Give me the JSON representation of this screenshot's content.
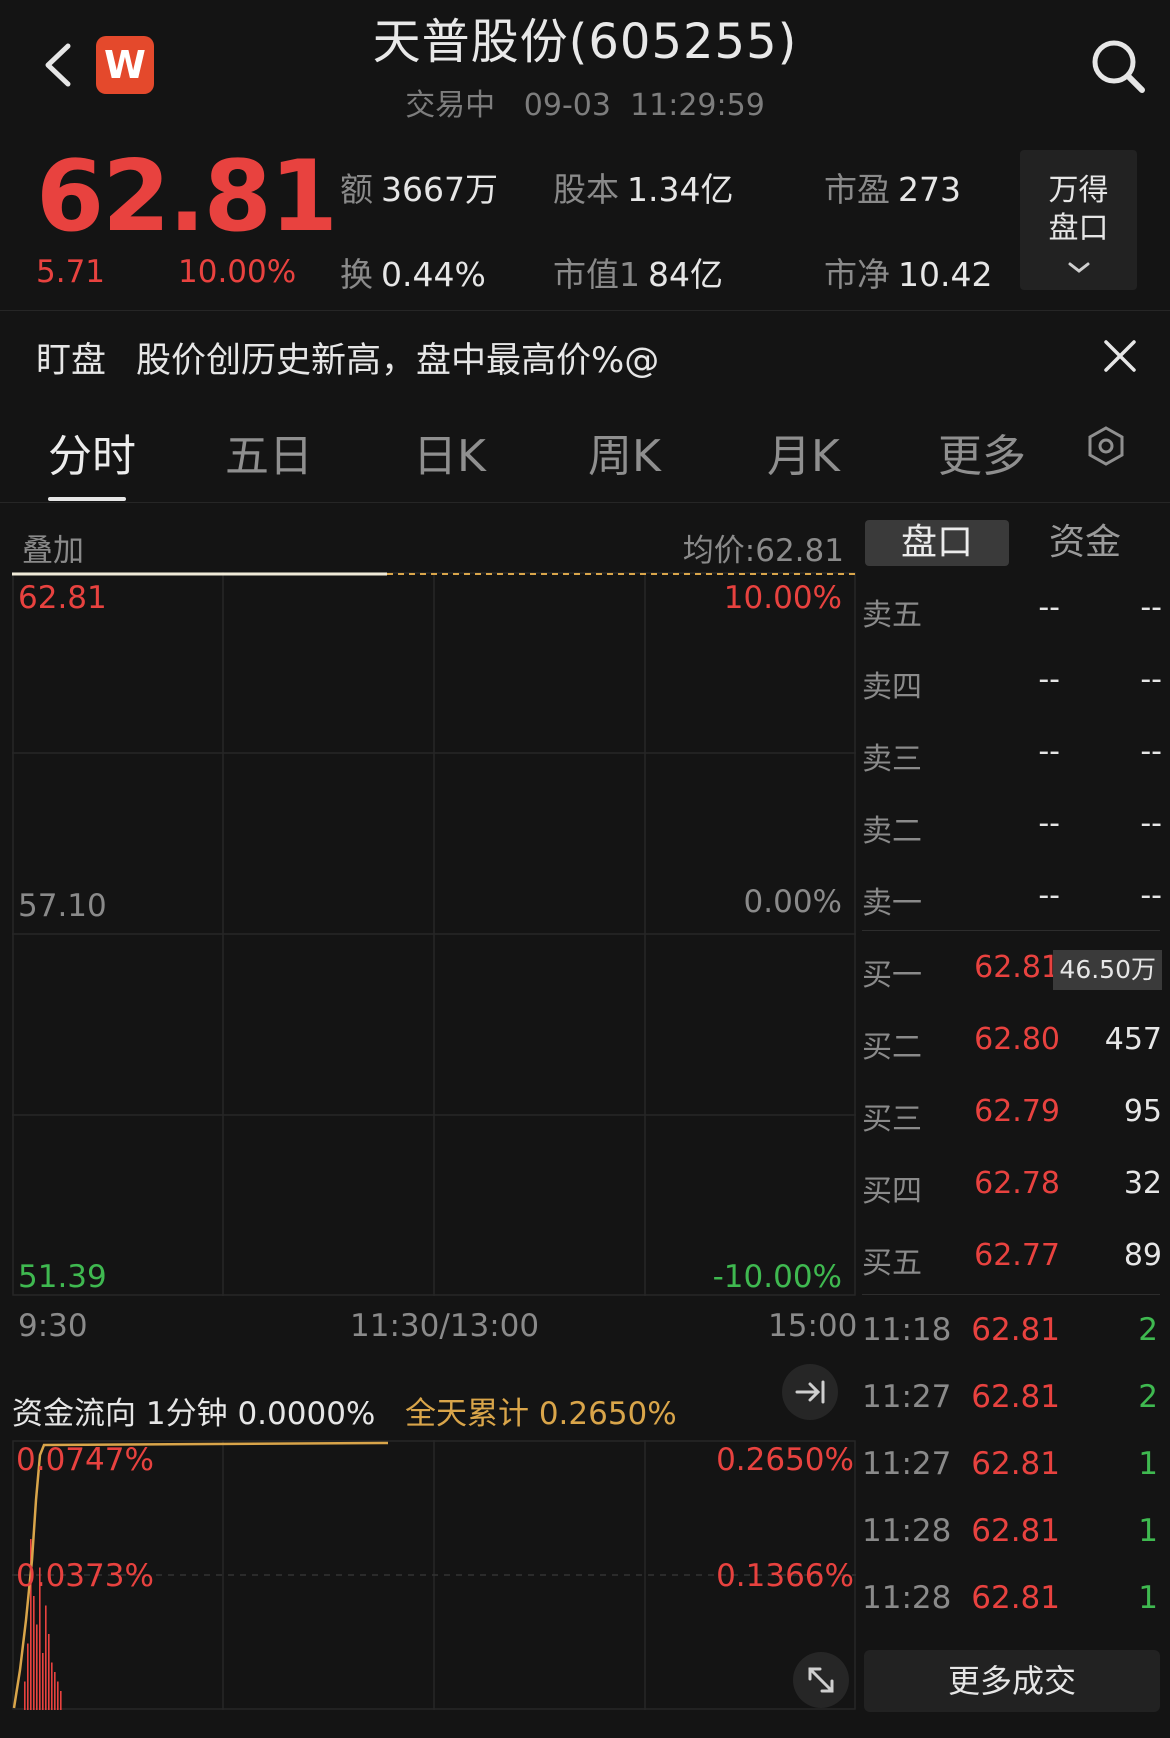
{
  "header": {
    "title": "天普股份(605255)",
    "status": "交易中",
    "date": "09-03",
    "time": "11:29:59",
    "logo_letter": "W"
  },
  "quote": {
    "price": "62.81",
    "change": "5.71",
    "change_pct": "10.00%",
    "stats": [
      {
        "key": "额",
        "value": "3667万"
      },
      {
        "key": "股本",
        "value": "1.34亿"
      },
      {
        "key": "市盈",
        "value": "273"
      },
      {
        "key": "换",
        "value": "0.44%"
      },
      {
        "key": "市值1",
        "value": "84亿"
      },
      {
        "key": "市净",
        "value": "10.42"
      }
    ],
    "wind_button": [
      "万得",
      "盘口"
    ]
  },
  "notice": {
    "label": "盯盘",
    "text": "股价创历史新高，盘中最高价%@"
  },
  "tabs": [
    "分时",
    "五日",
    "日K",
    "周K",
    "月K",
    "更多"
  ],
  "active_tab": "分时",
  "main_chart": {
    "overlay_label": "叠加",
    "avg_price_label": "均价:62.81",
    "price_high": "62.81",
    "price_mid": "57.10",
    "price_low": "51.39",
    "pct_high": "10.00%",
    "pct_mid": "0.00%",
    "pct_low": "-10.00%",
    "time_start": "9:30",
    "time_mid": "11:30/13:00",
    "time_end": "15:00"
  },
  "flow": {
    "label": "资金流向",
    "interval": "1分钟",
    "interval_value": "0.0000%",
    "cumulative_label": "全天累计",
    "cumulative_value": "0.2650%",
    "left_top": "0.0747%",
    "left_mid": "0.0373%",
    "right_top": "0.2650%",
    "right_mid": "0.1366%"
  },
  "chart_data": {
    "type": "line",
    "title": "",
    "x_range": [
      "9:30",
      "15:00"
    ],
    "price_ylim": [
      51.39,
      62.81
    ],
    "series": [
      {
        "values": [
          62.81,
          62.81
        ]
      }
    ],
    "flow_ylim_left": [
      0,
      0.0747
    ],
    "flow_ylim_right": [
      0,
      0.265
    ]
  },
  "order_book": {
    "tabs": [
      "盘口",
      "资金"
    ],
    "asks": [
      {
        "label": "卖五",
        "price": "--",
        "volume": "--"
      },
      {
        "label": "卖四",
        "price": "--",
        "volume": "--"
      },
      {
        "label": "卖三",
        "price": "--",
        "volume": "--"
      },
      {
        "label": "卖二",
        "price": "--",
        "volume": "--"
      },
      {
        "label": "卖一",
        "price": "--",
        "volume": "--"
      }
    ],
    "bids": [
      {
        "label": "买一",
        "price": "62.81",
        "volume": "46.50万"
      },
      {
        "label": "买二",
        "price": "62.80",
        "volume": "457"
      },
      {
        "label": "买三",
        "price": "62.79",
        "volume": "95"
      },
      {
        "label": "买四",
        "price": "62.78",
        "volume": "32"
      },
      {
        "label": "买五",
        "price": "62.77",
        "volume": "89"
      }
    ],
    "trades": [
      {
        "time": "11:18",
        "price": "62.81",
        "volume": "2"
      },
      {
        "time": "11:27",
        "price": "62.81",
        "volume": "2"
      },
      {
        "time": "11:27",
        "price": "62.81",
        "volume": "1"
      },
      {
        "time": "11:28",
        "price": "62.81",
        "volume": "1"
      },
      {
        "time": "11:28",
        "price": "62.81",
        "volume": "1"
      }
    ],
    "more_trades": "更多成交"
  },
  "colors": {
    "up": "#e8423f",
    "down": "#3fb950",
    "avg_line": "#d9a54a",
    "background": "#141414"
  }
}
